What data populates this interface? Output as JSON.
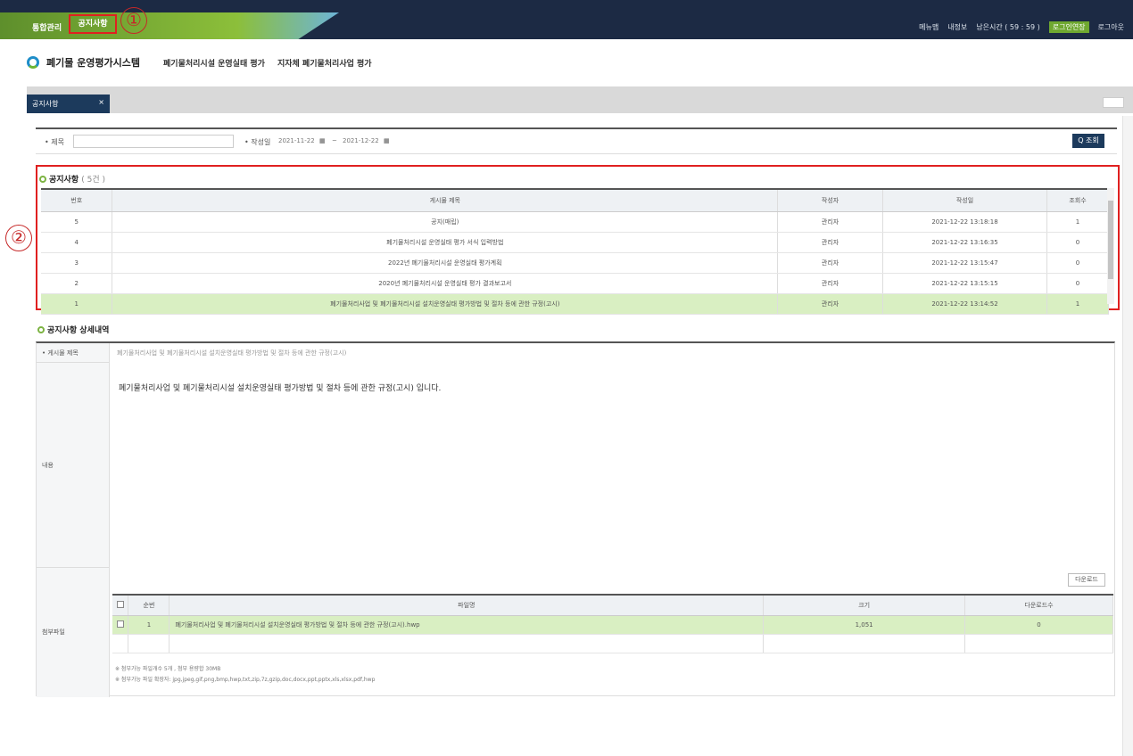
{
  "topbar": {
    "menu_a": "통합관리",
    "menu_b": "공지사항",
    "marker_1": "①",
    "right_items": [
      "메뉴맵",
      "내정보",
      "남은시간 ( 59 : 59 )",
      "로그인연장",
      "로그아웃"
    ]
  },
  "logo": {
    "title": "폐기물 운영평가시스템"
  },
  "nav": [
    "폐기물처리시설 운영실태 평가",
    "지자체 폐기물처리사업 평가"
  ],
  "tab": {
    "label": "공지사항",
    "close": "×"
  },
  "search": {
    "title_label": "• 제목",
    "date_label": "• 작성일",
    "date_from": "2021-11-22",
    "date_to": "2021-12-22",
    "separator": "~",
    "query_button": "Q 조회"
  },
  "notice_list": {
    "title": "공지사항",
    "count": "( 5건 )",
    "marker_2": "②",
    "columns": [
      "번호",
      "게시물 제목",
      "작성자",
      "작성일",
      "조회수"
    ],
    "rows": [
      {
        "no": "5",
        "title": "공지(매립)",
        "author": "관리자",
        "date": "2021-12-22 13:18:18",
        "views": "1"
      },
      {
        "no": "4",
        "title": "폐기물처리시설 운영실태 평가 서식 입력방법",
        "author": "관리자",
        "date": "2021-12-22 13:16:35",
        "views": "0"
      },
      {
        "no": "3",
        "title": "2022년 폐기물처리시설 운영실태 평가계획",
        "author": "관리자",
        "date": "2021-12-22 13:15:47",
        "views": "0"
      },
      {
        "no": "2",
        "title": "2020년 폐기물처리시설 운영실태 평가 결과보고서",
        "author": "관리자",
        "date": "2021-12-22 13:15:15",
        "views": "0"
      },
      {
        "no": "1",
        "title": "폐기물처리사업 및 폐기물처리시설 설치운영실태 평가방법 및 절차 등에 관한 규정(고시)",
        "author": "관리자",
        "date": "2021-12-22 13:14:52",
        "views": "1"
      }
    ],
    "selected_index": 4
  },
  "detail": {
    "title": "공지사항 상세내역",
    "subject_label": "• 게시물 제목",
    "subject_value": "폐기물처리사업 및 폐기물처리시설 설치운영실태 평가방법 및 절차 등에 관한 규정(고시)",
    "content_label": "내용",
    "content": "폐기물처리사업 및 폐기물처리시설 설치운영실태 평가방법 및 절차 등에 관한 규정(고시) 입니다.",
    "attach_label": "첨부파일",
    "download_button": "다운로드",
    "file_columns": [
      "",
      "순번",
      "파일명",
      "크기",
      "다운로드수"
    ],
    "files": [
      {
        "no": "1",
        "name": "폐기물처리사업 및 폐기물처리시설 설치운영실태 평가방법 및 절차 등에 관한 규정(고시).hwp",
        "size": "1,051",
        "downloads": "0"
      }
    ],
    "notes": [
      "※ 첨부가능 파일개수 5개 , 첨부 용량합 30MB",
      "※ 첨부가능 파일 확장자: jpg,jpeg,gif,png,bmp,hwp,txt,zip,7z,gzip,doc,docx,ppt,pptx,xls,xlsx,pdf,hwp"
    ]
  },
  "colors": {
    "navy": "#1c2a44",
    "green": "#6fa830",
    "highlight": "#d9efc2",
    "marker": "#e02020"
  }
}
